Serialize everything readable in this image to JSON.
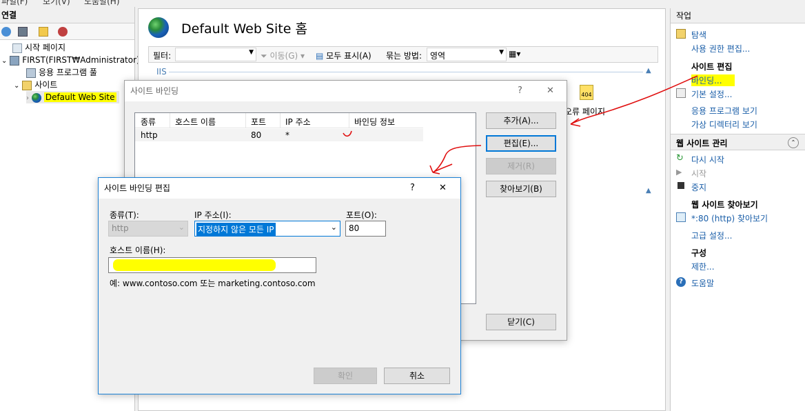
{
  "menubar": {
    "items": [
      "파일(F)",
      "보기(V)",
      "도움말(H)"
    ]
  },
  "connections": {
    "title": "연결",
    "tree": [
      {
        "label": "시작 페이지"
      },
      {
        "label": "FIRST(FIRST₩Administrator)"
      },
      {
        "label": "응용 프로그램 풀"
      },
      {
        "label": "사이트"
      },
      {
        "label": "Default Web Site"
      }
    ]
  },
  "center": {
    "title": "Default Web Site 홈",
    "filter_label": "필터:",
    "go_label": "이동(G)",
    "show_all_label": "모두 표시(A)",
    "group_by_label": "묶는 방법:",
    "group_by_value": "영역",
    "section_iis": "IIS",
    "error_pages_label": "오류 페이지",
    "error_icon_text": "404"
  },
  "actions": {
    "title": "작업",
    "explore": "탐색",
    "edit_permissions": "사용 권한 편집...",
    "edit_site_title": "사이트 편집",
    "bindings": "바인딩...",
    "basic_settings": "기본 설정...",
    "view_applications": "응용 프로그램 보기",
    "view_virtual_dirs": "가상 디렉터리 보기",
    "manage_site_title": "웹 사이트 관리",
    "restart": "다시 시작",
    "start": "시작",
    "stop": "중지",
    "browse_site_title": "웹 사이트 찾아보기",
    "browse_80": "*:80 (http) 찾아보기",
    "advanced_settings": "고급 설정...",
    "config_title": "구성",
    "limits": "제한...",
    "help": "도움말"
  },
  "site_bindings": {
    "title": "사이트 바인딩",
    "help_glyph": "?",
    "close_glyph": "✕",
    "columns": [
      "종류",
      "호스트 이름",
      "포트",
      "IP 주소",
      "바인딩 정보"
    ],
    "rows": [
      {
        "type": "http",
        "host": "",
        "port": "80",
        "ip": "*",
        "info": ""
      }
    ],
    "add_button": "추가(A)...",
    "edit_button": "편집(E)...",
    "remove_button": "제거(R)",
    "browse_button": "찾아보기(B)",
    "close_button": "닫기(C)"
  },
  "edit_binding": {
    "title": "사이트 바인딩 편집",
    "help_glyph": "?",
    "close_glyph": "✕",
    "type_label": "종류(T):",
    "type_value": "http",
    "ip_label": "IP 주소(I):",
    "ip_value": "지정하지 않은 모든 IP",
    "port_label": "포트(O):",
    "port_value": "80",
    "host_label": "호스트 이름(H):",
    "host_value": "",
    "example_text": "예: www.contoso.com 또는 marketing.contoso.com",
    "ok_button": "확인",
    "cancel_button": "취소"
  },
  "colors": {
    "highlight": "#ffff00",
    "link": "#1a5ea8",
    "annotation": "#e01010",
    "selection": "#0078d7"
  }
}
